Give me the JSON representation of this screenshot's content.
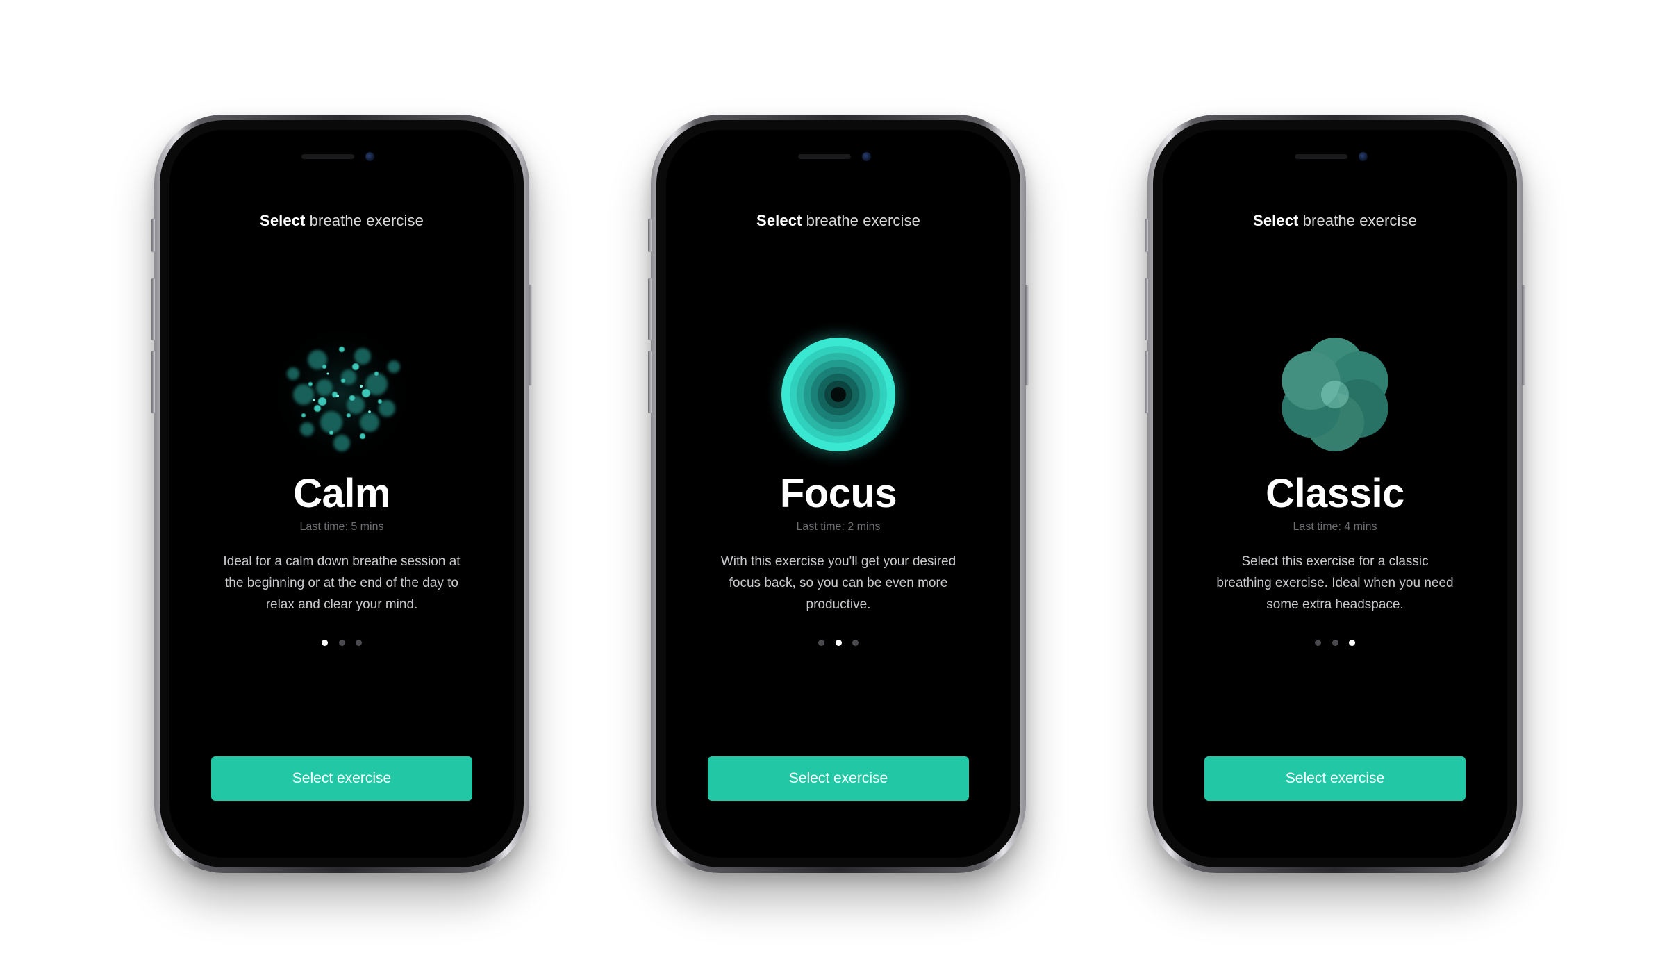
{
  "header": {
    "bold": "Select",
    "rest": " breathe exercise"
  },
  "accent_color": "#22c7a6",
  "screens": [
    {
      "title": "Calm",
      "last_time": "Last time: 5 mins",
      "description": "Ideal for a calm down breathe session at the beginning or at the end of the day to relax and clear your mind.",
      "button": "Select exercise",
      "active_page": 0,
      "art": "particles"
    },
    {
      "title": "Focus",
      "last_time": "Last time: 2 mins",
      "description": "With this exercise you'll get your desired focus back, so you can be even more productive.",
      "button": "Select exercise",
      "active_page": 1,
      "art": "rings"
    },
    {
      "title": "Classic",
      "last_time": "Last time: 4 mins",
      "description": "Select this exercise for a classic breathing exercise. Ideal when you need some extra headspace.",
      "button": "Select exercise",
      "active_page": 2,
      "art": "flower"
    }
  ],
  "page_count": 3
}
